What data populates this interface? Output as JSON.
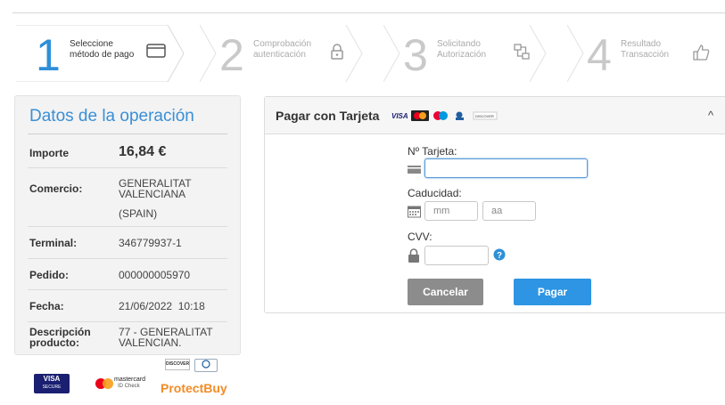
{
  "steps": [
    {
      "number": "1",
      "line1": "Seleccione",
      "line2": "método de pago",
      "icon": "card-icon"
    },
    {
      "number": "2",
      "line1": "Comprobación",
      "line2": "autenticación",
      "icon": "lock-icon"
    },
    {
      "number": "3",
      "line1": "Solicitando",
      "line2": "Autorización",
      "icon": "network-icon"
    },
    {
      "number": "4",
      "line1": "Resultado",
      "line2": "Transacción",
      "icon": "thumbs-up-icon"
    }
  ],
  "summary": {
    "title": "Datos de la operación",
    "rows": [
      {
        "label": "Importe",
        "value": "16,84 €"
      },
      {
        "label": "Comercio:",
        "value": "GENERALITAT VALENCIANA",
        "value2": "(SPAIN)"
      },
      {
        "label": "Terminal:",
        "value": "346779937-1"
      },
      {
        "label": "Pedido:",
        "value": "000000005970"
      },
      {
        "label": "Fecha:",
        "value": "21/06/2022  10:18"
      },
      {
        "label": "Descripción producto:",
        "value": "77 - GENERALITAT VALENCIAN."
      }
    ]
  },
  "logos": {
    "visa_top": "VISA",
    "visa_bottom": "SECURE",
    "mastercard_line1": "mastercard",
    "mastercard_line2": "ID Check",
    "discover": "DISCOVER",
    "protectbuy": "ProtectBuy",
    "diners": "Diners Club"
  },
  "card": {
    "title": "Pagar con Tarjeta",
    "card_number_label": "Nº Tarjeta:",
    "card_number_value": "",
    "expiry_label": "Caducidad:",
    "month_placeholder": "mm",
    "year_placeholder": "aa",
    "cvv_label": "CVV:",
    "cvv_value": "",
    "cancel_label": "Cancelar",
    "pay_label": "Pagar"
  },
  "colors": {
    "accent": "#2d8fd8",
    "pay_button": "#2d95e3",
    "cancel_button": "#8c8c8c"
  }
}
